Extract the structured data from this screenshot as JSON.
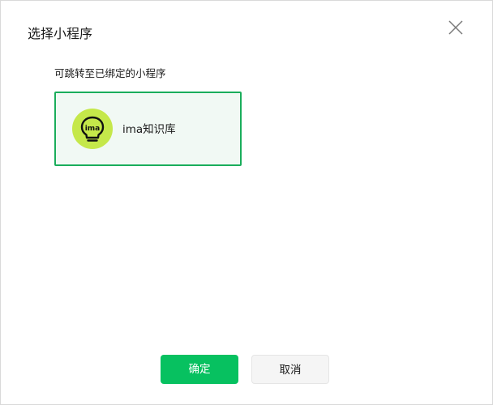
{
  "dialog": {
    "title": "选择小程序",
    "close_icon": "close-icon"
  },
  "hint": "可跳转至已绑定的小程序",
  "programs": [
    {
      "name": "ima知识库",
      "logo_text": "ima",
      "icon": "lightbulb-icon",
      "selected": true,
      "avatar_color": "#c5e84a"
    }
  ],
  "buttons": {
    "confirm_label": "确定",
    "cancel_label": "取消"
  },
  "colors": {
    "accent": "#07c160",
    "selected_border": "#1aad5b",
    "selected_bg": "#f1f9f4"
  }
}
